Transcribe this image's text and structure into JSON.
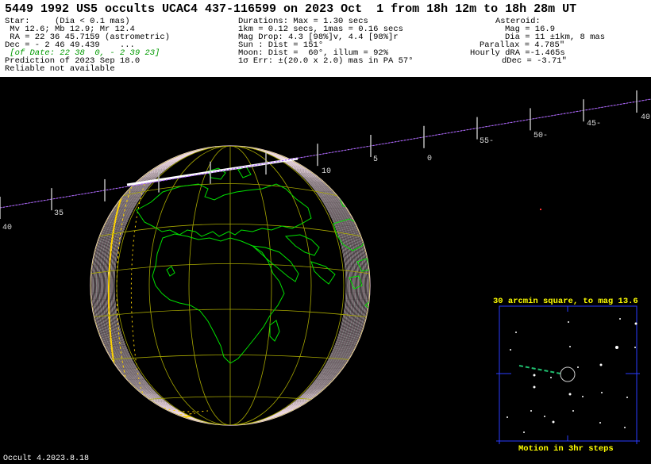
{
  "title": "5449 1992 US5 occults UCAC4 437-116599 on 2023 Oct  1 from 18h 12m to 18h 28m UT",
  "star": [
    "Star:     (Dia < 0.1 mas)",
    " Mv 12.6; Mb 12.9; Mr 12.4",
    " RA = 22 36 45.7159 (astrometric)",
    "Dec = - 2 46 49.439    ...",
    " [of Date: 22 38  0, - 2 39 23]",
    "Prediction of 2023 Sep 18.0",
    "Reliable not available"
  ],
  "event": [
    "Durations: Max = 1.30 secs",
    "1km = 0.12 secs, 1mas = 0.16 secs",
    "Mag Drop: 4.3 [98%]v, 4.4 [98%]r",
    "Sun : Dist = 151°",
    "Moon: Dist =  60°, illum = 92%",
    "1σ Err: ±(20.0 x 2.0) mas in PA 57°"
  ],
  "asteroid": [
    "Asteroid:",
    "Mag = 16.9",
    "Dia = 11 ±1km, 8 mas",
    "Parallax = 4.785\"",
    "Hourly dRA =-1.465s",
    "dDec = -3.71\""
  ],
  "track_labels": {
    "l40a": "40",
    "l35": "35",
    "l10": "10",
    "l5": "5",
    "l0": "0",
    "l55": "55-",
    "l50": "50-",
    "l45": "45-",
    "l40b": "40"
  },
  "inset": {
    "title": "30 arcmin square, to mag 13.6",
    "caption": "Motion in 3hr steps"
  },
  "footer": "Occult 4.2023.8.18",
  "colors": {
    "coast": "#00e000",
    "grid": "#a8a800",
    "track": "#9b30ff",
    "inset_frame": "#2a3cff",
    "inset_text": "#ffff00"
  }
}
